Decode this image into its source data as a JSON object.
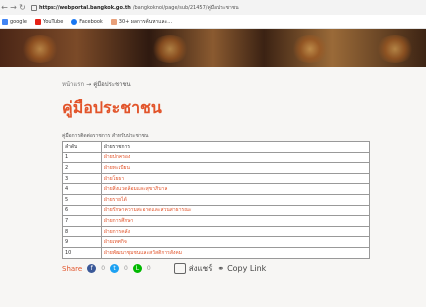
{
  "browser": {
    "url_host": "https://webportal.bangkok.go.th",
    "url_path": "/bangkoknoi/page/sub/21457/คู่มือประชาชน"
  },
  "bookmarks": [
    {
      "label": "google",
      "color": "#4285f4"
    },
    {
      "label": "YouTube",
      "color": "#e62117"
    },
    {
      "label": "Facebook",
      "color": "#1877f2"
    },
    {
      "label": "30+ ผลการค้นหาและ...",
      "color": "#e8a07a"
    }
  ],
  "breadcrumb": {
    "home": "หน้าแรก",
    "arrow": "→",
    "current": "คู่มือประชาชน"
  },
  "page_title": "คู่มือประชาชน",
  "table_caption": "คู่มือการติดต่อราชการ สำหรับประชาชน",
  "table": {
    "headers": [
      "ลำดับ",
      "ฝ่ายราชการ"
    ],
    "rows": [
      {
        "no": "1",
        "name": "ฝ่ายปกครอง"
      },
      {
        "no": "2",
        "name": "ฝ่ายทะเบียน"
      },
      {
        "no": "3",
        "name": "ฝ่ายโยธา"
      },
      {
        "no": "4",
        "name": "ฝ่ายสิ่งแวดล้อมและสุขาภิบาล"
      },
      {
        "no": "5",
        "name": "ฝ่ายรายได้"
      },
      {
        "no": "6",
        "name": "ฝ่ายรักษาความสะอาดและสวนสาธารณะ"
      },
      {
        "no": "7",
        "name": "ฝ่ายการศึกษา"
      },
      {
        "no": "8",
        "name": "ฝ่ายการคลัง"
      },
      {
        "no": "9",
        "name": "ฝ่ายเทศกิจ"
      },
      {
        "no": "10",
        "name": "ฝ่ายพัฒนาชุมชนและสวัสดิการสังคม"
      }
    ]
  },
  "share": {
    "label": "Share",
    "facebook_count": "0",
    "twitter_count": "0",
    "line_count": "0",
    "line_label": "ส่งแชร์",
    "copy_label": "Copy Link"
  }
}
